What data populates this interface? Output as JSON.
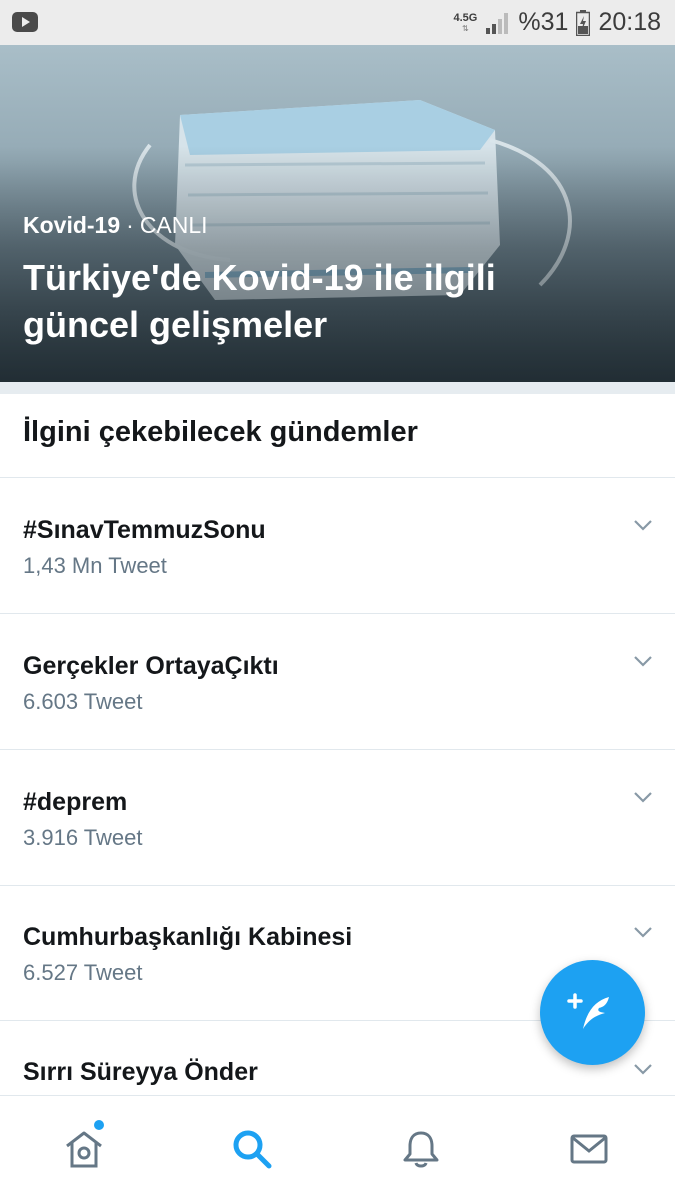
{
  "status_bar": {
    "network": "4.5G",
    "battery_percent": "%31",
    "time": "20:18"
  },
  "hero": {
    "topic": "Kovid-19",
    "separator": "·",
    "live_label": "CANLI",
    "title": "Türkiye'de Kovid-19 ile ilgili güncel gelişmeler"
  },
  "section": {
    "title": "İlgini çekebilecek gündemler"
  },
  "trends": [
    {
      "name": "#SınavTemmuzSonu",
      "count": "1,43 Mn Tweet"
    },
    {
      "name": "Gerçekler OrtayaÇıktı",
      "count": "6.603 Tweet"
    },
    {
      "name": "#deprem",
      "count": "3.916 Tweet"
    },
    {
      "name": "Cumhurbaşkanlığı Kabinesi",
      "count": "6.527 Tweet"
    },
    {
      "name": "Sırrı Süreyya Önder",
      "count": ""
    }
  ],
  "bottom_nav": {
    "items": [
      {
        "icon": "home-icon",
        "active": false,
        "has_badge": true
      },
      {
        "icon": "search-icon",
        "active": true,
        "has_badge": false
      },
      {
        "icon": "bell-icon",
        "active": false,
        "has_badge": false
      },
      {
        "icon": "mail-icon",
        "active": false,
        "has_badge": false
      }
    ]
  },
  "colors": {
    "accent": "#1da1f2",
    "text_primary": "#14171a",
    "text_secondary": "#657786",
    "divider": "#e1e8ed"
  }
}
